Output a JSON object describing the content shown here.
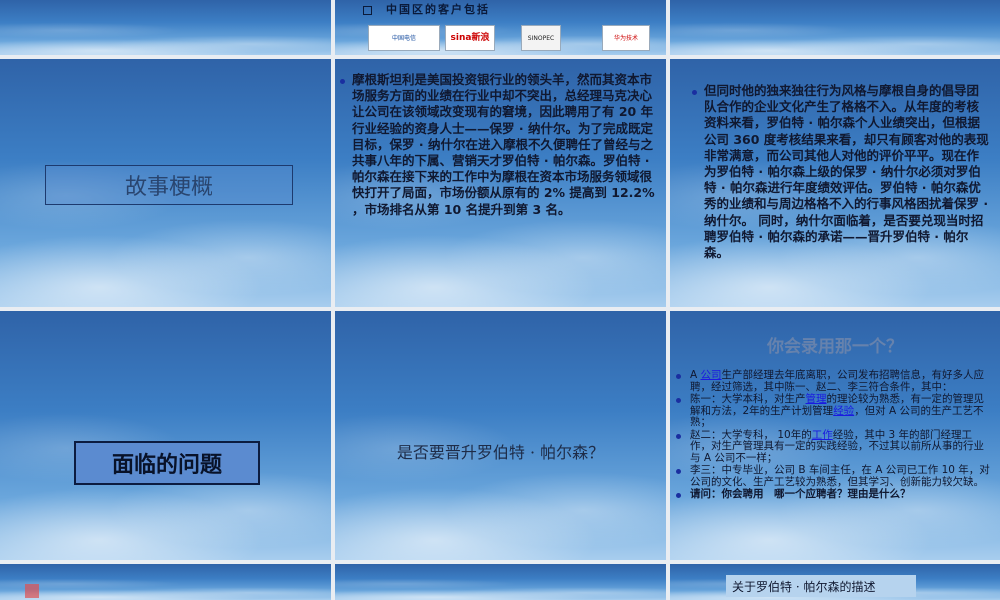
{
  "top_row": {
    "clients_title": "中国区的客户包括",
    "logos": [
      {
        "name": "china-telecom-logo",
        "text": "中国电信"
      },
      {
        "name": "sina-logo",
        "text": "sina新浪"
      },
      {
        "name": "sinopec-logo",
        "text": "SINOPEC"
      },
      {
        "name": "huawei-logo",
        "text": "华为技术"
      }
    ]
  },
  "row1": {
    "title": "故事梗概",
    "para1": "摩根斯坦利是美国投资银行业的领头羊，然而其资本市场服务方面的业绩在行业中却不突出，总经理马克决心让公司在该领域改变现有的窘境，因此聘用了有 20 年行业经验的资身人士——保罗 · 纳什尔。为了完成既定目标，保罗 · 纳什尔在进入摩根不久便聘任了曾经与之共事八年的下属、营销天才罗伯特 · 帕尔森。罗伯特 · 帕尔森在接下来的工作中为摩根在资本市场服务领域很快打开了局面，市场份额从原有的 2% 提高到 12.2% ，市场排名从第 10 名提升到第 3 名。",
    "para2": "但同时他的独来独往行为风格与摩根自身的倡导团队合作的企业文化产生了格格不入。从年度的考核资料来看，罗伯特 · 帕尔森个人业绩突出，但根据公司 360 度考核结果来看，却只有顾客对他的表现非常满意，而公司其他人对他的评价平平。现在作为罗伯特 · 帕尔森上级的保罗 · 纳什尔必须对罗伯特 · 帕尔森进行年度绩效评估。罗伯特 · 帕尔森优秀的业绩和与周边格格不入的行事风格困扰着保罗 · 纳什尔。 同时，纳什尔面临着，是否要兑现当时招聘罗伯特 · 帕尔森的承诺——晋升罗伯特 · 帕尔森。"
  },
  "row2": {
    "problem_title": "面临的问题",
    "question": "是否要晋升罗伯特 · 帕尔森？",
    "hire_title": "你会录用那一个？",
    "hire_items": [
      {
        "pre": "A ",
        "link": "公司",
        "post": "生产部经理去年底离职，公司发布招聘信息，有好多人应聘，经过筛选，其中陈一、赵二、李三符合条件，其中："
      },
      {
        "pre": "陈一：大学本科，对生产",
        "link": "管理",
        "post": "的理论较为熟悉，有一定的管理见解和方法，2年的生产计划管理",
        "link2": "经验",
        "post2": "，但对 A 公司的生产工艺不熟；"
      },
      {
        "pre": "赵二：大学专科， 10年的",
        "link": "工作",
        "post": "经验，其中 3 年的部门经理工作，对生产管理具有一定的实践经验，不过其以前所从事的行业与 A 公司不一样；"
      },
      {
        "pre": "李三：中专毕业，公司 B 车间主任，在 A 公司已工作 10 年，对公司的文化、生产工艺较为熟悉，但其学习、创新能力较欠缺。",
        "link": "",
        "post": ""
      },
      {
        "pre": "请问：你会聘用　哪一个应聘者？理由是什么？",
        "link": "",
        "post": ""
      }
    ]
  },
  "bottom_row": {
    "desc_title": "关于罗伯特 · 帕尔森的描述"
  }
}
